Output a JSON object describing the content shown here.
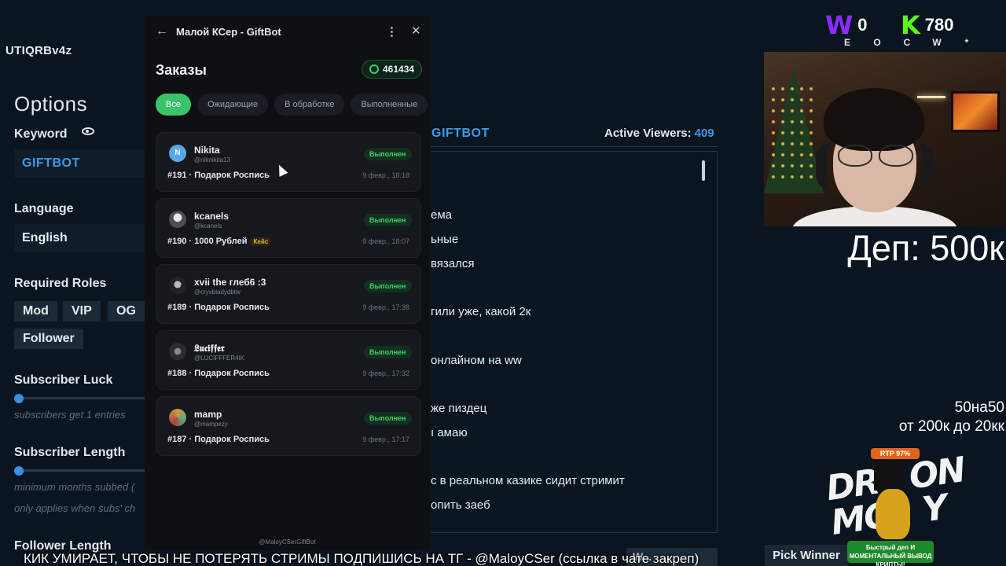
{
  "settings": {
    "channel_id": "UTIQRBv4z",
    "options_title": "Options",
    "keyword_label": "Keyword",
    "keyword_value": "GIFTBOT",
    "language_label": "Language",
    "language_value": "English",
    "roles_label": "Required Roles",
    "roles": [
      "Mod",
      "VIP",
      "OG",
      "Follower"
    ],
    "sub_luck_label": "Subscriber Luck",
    "sub_luck_hint": "subscribers get 1 entries",
    "sub_length_label": "Subscriber Length",
    "sub_length_hint1": "minimum months subbed (",
    "sub_length_hint2": "only applies when subs' ch",
    "follower_length_label": "Follower Length"
  },
  "giveaway": {
    "keyword_title": "GIFTBOT",
    "viewers_label": "Active Viewers:",
    "viewers_count": "409",
    "chat": [
      "ема",
      "ьные",
      "вязался",
      "гили уже, какой 2к",
      "онлайном на ww",
      "же пиздец",
      "ı амаю",
      "с в реальном казике сидит стримит",
      "опить заеб"
    ],
    "bottom_button": "W...",
    "pick_winner": "Pick Winner"
  },
  "panel": {
    "title": "Малой КСер - GiftBot",
    "heading": "Заказы",
    "balance": "461434",
    "tabs": [
      "Все",
      "Ожидающие",
      "В обработке",
      "Выполненные"
    ],
    "orders": [
      {
        "name": "Nikita",
        "handle": "@niknikita13",
        "status": "Выполнен",
        "item": "#191 · Подарок Роспись",
        "tag": "",
        "date": "9 февр., 18:18",
        "avatar": "N",
        "avatar_color": "#5aa8e6"
      },
      {
        "name": "kcanels",
        "handle": "@kcanels",
        "status": "Выполнен",
        "item": "#190 · 1000 Рублей",
        "tag": "Кейс",
        "date": "9 февр., 18:07",
        "avatar": "",
        "avatar_color": "#7a7f86"
      },
      {
        "name": "xvii the глеб6 :3",
        "handle": "@cryxbladydbtw",
        "status": "Выполнен",
        "item": "#189 · Подарок Роспись",
        "tag": "",
        "date": "9 февр., 17:38",
        "avatar": "",
        "avatar_color": "#3b3f45"
      },
      {
        "name": "𝕷𝖚𝖈𝖎𝖋𝖋𝖊𝖗",
        "handle": "@LUCIFFFER4IK",
        "status": "Выполнен",
        "item": "#188 · Подарок Роспись",
        "tag": "",
        "date": "9 февр., 17:32",
        "avatar": "",
        "avatar_color": "#4a4e54"
      },
      {
        "name": "mamp",
        "handle": "@mampezy",
        "status": "Выполнен",
        "item": "#187 · Подарок Роспись",
        "tag": "",
        "date": "9 февр., 17:17",
        "avatar": "",
        "avatar_color": "#6a5a4a"
      }
    ],
    "footer": "@MaloyCSerGiftBot"
  },
  "overlay": {
    "score_w": "0",
    "score_k": "780",
    "keys": [
      "E",
      "O",
      "C",
      "W",
      "*"
    ],
    "deposit": "Деп: 500к",
    "line1": "50на50",
    "line2": "от 200к до 20кк",
    "promo_rtp": "RTP 97%",
    "promo_brand": "DRAGON MONEY",
    "promo_badge": "Быстрый деп И МОМЕНТАЛЬНЫЙ ВЫВОД КРИПТЫ!",
    "ticker": "КИК УМИРАЕТ, ЧТОБЫ НЕ ПОТЕРЯТЬ СТРИМЫ ПОДПИШИСЬ НА ТГ - @MaloyCSer (ссылка в чате закреп)"
  },
  "colors": {
    "accent": "#3d9ae8",
    "success": "#3bc36a",
    "kick": "#53fc18",
    "warning": "#8e2bff"
  }
}
